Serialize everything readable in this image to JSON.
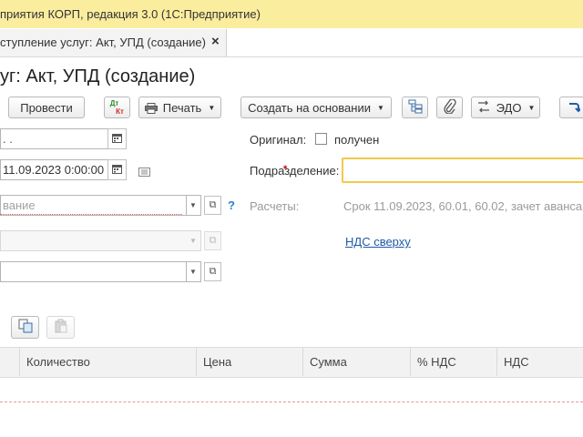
{
  "window": {
    "title": "приятия КОРП, редакция 3.0  (1С:Предприятие)"
  },
  "tab": {
    "label": "ступление услуг: Акт, УПД (создание)",
    "close": "×"
  },
  "form": {
    "title": "уг: Акт, УПД (создание)"
  },
  "toolbar": {
    "post_label": "Провести",
    "dtkt_label_top": "Дт",
    "dtkt_label_bottom": "Кт",
    "print_label": "Печать",
    "create_based_label": "Создать на основании",
    "edo_label": "ЭДО"
  },
  "fields": {
    "number_value": " .  .",
    "date_value": "11.09.2023  0:00:00",
    "counterparty_placeholder": "вание",
    "original_label": "Оригинал:",
    "original_checkbox_label": "получен",
    "division_label": "Подразделение:",
    "division_value": "",
    "settlements_label": "Расчеты:",
    "settlements_value": "Срок 11.09.2023, 60.01, 60.02, зачет аванса",
    "vat_link": "НДС сверху",
    "help_mark": "?"
  },
  "table": {
    "columns": [
      "Количество",
      "Цена",
      "Сумма",
      "% НДС",
      "НДС"
    ]
  }
}
